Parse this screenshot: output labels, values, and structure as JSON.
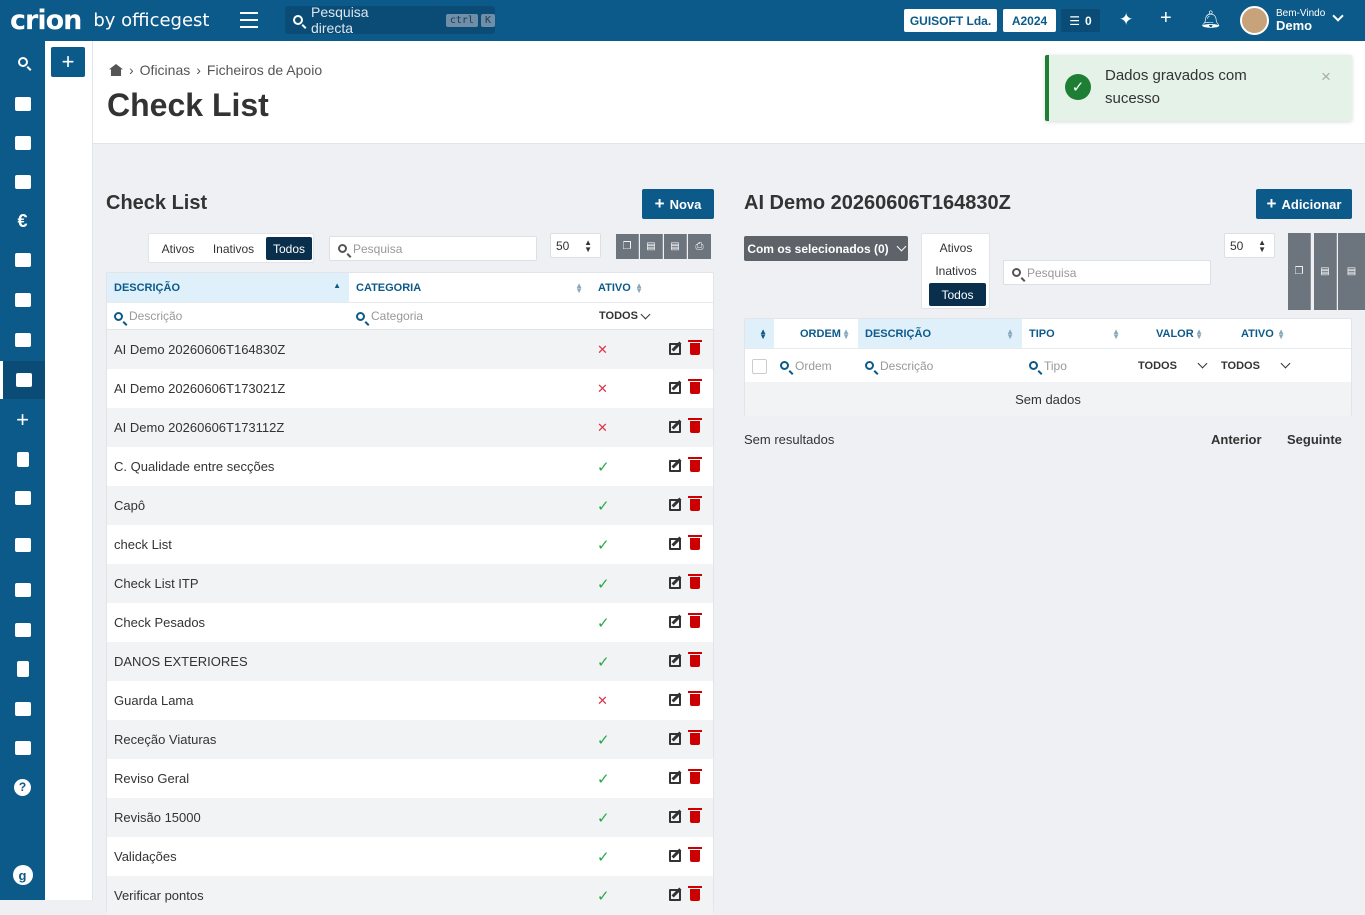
{
  "topbar": {
    "logo_main": "crion",
    "logo_sub": "by officegest",
    "search_placeholder": "Pesquisa directa",
    "kbd_ctrl": "ctrl",
    "kbd_k": "K",
    "company": "GUISOFT Lda.",
    "year": "A2024",
    "tasks_count": "0",
    "welcome": "Bem-Vindo",
    "user": "Demo"
  },
  "breadcrumb": {
    "items": [
      "Oficinas",
      "Ficheiros de Apoio"
    ]
  },
  "page_title": "Check List",
  "toast": {
    "message": "Dados gravados com sucesso",
    "close": "×"
  },
  "left": {
    "title": "Check List",
    "new_button": "Nova",
    "filters": {
      "active": "Ativos",
      "inactive": "Inativos",
      "all": "Todos"
    },
    "search_placeholder": "Pesquisa",
    "page_size": "50",
    "columns": {
      "description": "DESCRIÇÃO",
      "category": "CATEGORIA",
      "active": "ATIVO"
    },
    "filter_placeholders": {
      "description": "Descrição",
      "category": "Categoria",
      "active": "TODOS"
    },
    "rows": [
      {
        "description": "AI Demo 20260606T164830Z",
        "active": false
      },
      {
        "description": "AI Demo 20260606T173021Z",
        "active": false
      },
      {
        "description": "AI Demo 20260606T173112Z",
        "active": false
      },
      {
        "description": "C. Qualidade entre secções",
        "active": true
      },
      {
        "description": "Capô",
        "active": true
      },
      {
        "description": "check List",
        "active": true
      },
      {
        "description": "Check List ITP",
        "active": true
      },
      {
        "description": "Check Pesados",
        "active": true
      },
      {
        "description": "DANOS EXTERIORES",
        "active": true
      },
      {
        "description": "Guarda Lama",
        "active": false
      },
      {
        "description": "Receção Viaturas",
        "active": true
      },
      {
        "description": "Reviso Geral",
        "active": true
      },
      {
        "description": "Revisão 15000",
        "active": true
      },
      {
        "description": "Validações",
        "active": true
      },
      {
        "description": "Verificar pontos",
        "active": true
      }
    ]
  },
  "right": {
    "title": "AI Demo 20260606T164830Z",
    "add_button": "Adicionar",
    "bulk_action": "Com os selecionados (0)",
    "filters": {
      "active": "Ativos",
      "inactive": "Inativos",
      "all": "Todos"
    },
    "search_placeholder": "Pesquisa",
    "page_size": "50",
    "columns": {
      "order": "ORDEM",
      "description": "DESCRIÇÃO",
      "type": "TIPO",
      "value": "VALOR",
      "active": "ATIVO"
    },
    "filter_placeholders": {
      "order": "Ordem",
      "description": "Descrição",
      "type": "Tipo",
      "value": "TODOS",
      "active": "TODOS"
    },
    "empty": "Sem dados",
    "no_results": "Sem resultados",
    "prev": "Anterior",
    "next": "Seguinte"
  },
  "colors": {
    "primary": "#0c5a8a",
    "dark": "#0a2f4d",
    "success": "#28a745",
    "danger": "#dc3545"
  }
}
